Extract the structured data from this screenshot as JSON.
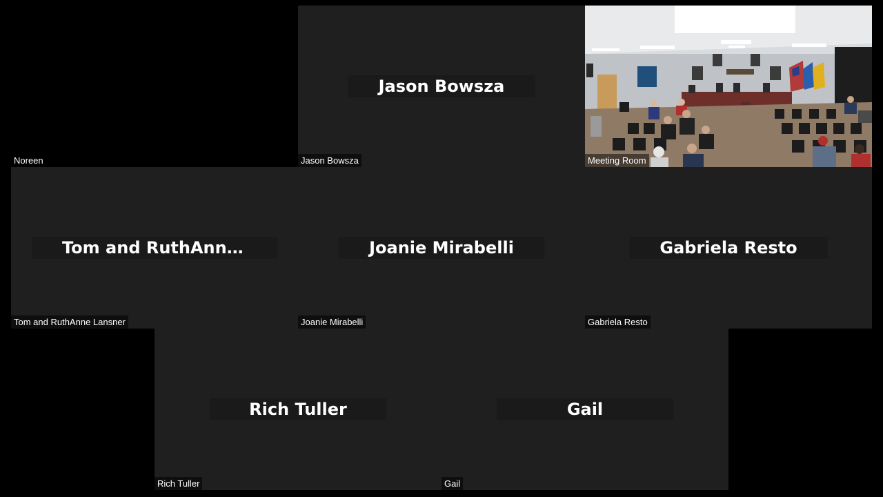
{
  "participants": [
    {
      "display_name": "Noreen",
      "center_label": "",
      "tile": "camera-off"
    },
    {
      "display_name": "Jason Bowsza",
      "center_label": "Jason Bowsza",
      "tile": "name-card"
    },
    {
      "display_name": "Meeting Room",
      "center_label": "",
      "tile": "video"
    },
    {
      "display_name": "Tom and RuthAnne Lansner",
      "center_label": "Tom and RuthAnne Lansner",
      "tile": "name-card"
    },
    {
      "display_name": "Joanie Mirabelli",
      "center_label": "Joanie Mirabelli",
      "tile": "name-card"
    },
    {
      "display_name": "Gabriela Resto",
      "center_label": "Gabriela Resto",
      "tile": "name-card"
    },
    {
      "display_name": "Rich Tuller",
      "center_label": "Rich Tuller",
      "tile": "name-card"
    },
    {
      "display_name": "Gail",
      "center_label": "Gail",
      "tile": "name-card"
    }
  ],
  "colors": {
    "background": "#000000",
    "tile": "#1f1f1f",
    "label_text": "#ffffff"
  }
}
